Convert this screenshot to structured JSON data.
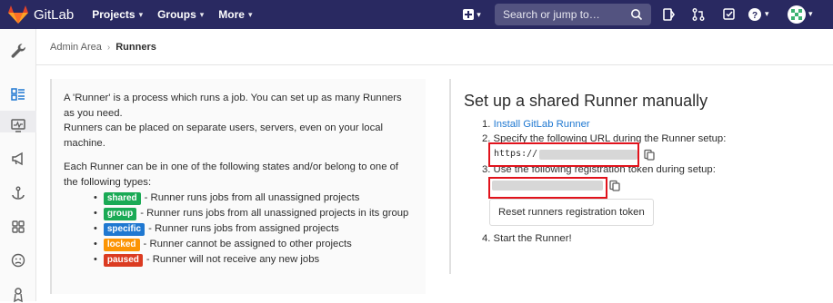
{
  "navbar": {
    "brand": "GitLab",
    "projects": "Projects",
    "groups": "Groups",
    "more": "More",
    "search_placeholder": "Search or jump to…"
  },
  "breadcrumb": {
    "parent": "Admin Area",
    "current": "Runners"
  },
  "info": {
    "intro_1": "A 'Runner' is a process which runs a job. You can set up as many Runners as you need.",
    "intro_2": "Runners can be placed on separate users, servers, even on your local machine.",
    "states_intro": "Each Runner can be in one of the following states and/or belong to one of the following types:",
    "states": [
      {
        "badge": "shared",
        "color": "#1aaa55",
        "text": "- Runner runs jobs from all unassigned projects"
      },
      {
        "badge": "group",
        "color": "#1aaa55",
        "text": "- Runner runs jobs from all unassigned projects in its group"
      },
      {
        "badge": "specific",
        "color": "#1f78d1",
        "text": "- Runner runs jobs from assigned projects"
      },
      {
        "badge": "locked",
        "color": "#fc9403",
        "text": "- Runner cannot be assigned to other projects"
      },
      {
        "badge": "paused",
        "color": "#db3b21",
        "text": "- Runner will not receive any new jobs"
      }
    ]
  },
  "setup": {
    "title": "Set up a shared Runner manually",
    "step1_num": "1.",
    "step1_link": "Install GitLab Runner",
    "step2": "2. Specify the following URL during the Runner setup:",
    "url_prefix": "https://",
    "step3": "3. Use the following registration token during setup:",
    "reset_button": "Reset runners registration token",
    "step4": "4. Start the Runner!"
  },
  "colors": {
    "navbar": "#292961",
    "link": "#1f78d1",
    "highlight": "#e1131c"
  }
}
